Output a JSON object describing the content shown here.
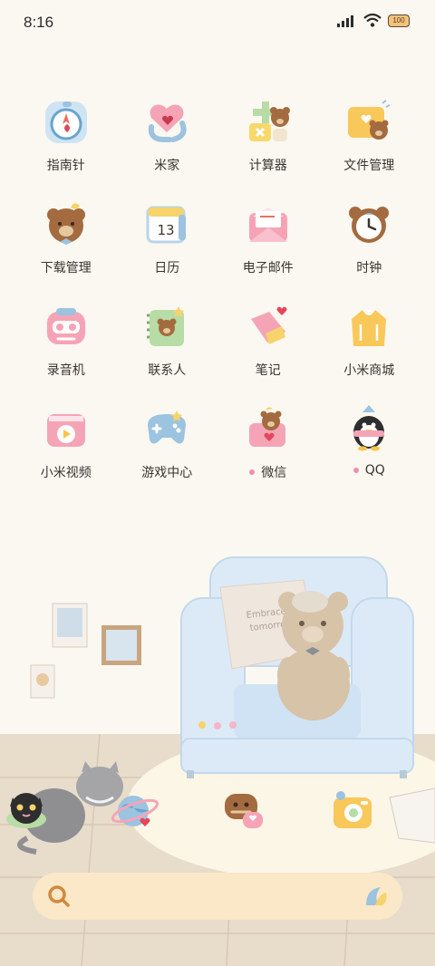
{
  "status_bar": {
    "time": "8:16",
    "battery_level": "100"
  },
  "apps": [
    {
      "label": "指南针",
      "icon": "compass-icon",
      "dot": false
    },
    {
      "label": "米家",
      "icon": "mi-home-icon",
      "dot": false
    },
    {
      "label": "计算器",
      "icon": "calculator-icon",
      "dot": false
    },
    {
      "label": "文件管理",
      "icon": "file-manager-icon",
      "dot": false
    },
    {
      "label": "下载管理",
      "icon": "downloads-icon",
      "dot": false
    },
    {
      "label": "日历",
      "icon": "calendar-icon",
      "dot": false,
      "badge": "13"
    },
    {
      "label": "电子邮件",
      "icon": "email-icon",
      "dot": false
    },
    {
      "label": "时钟",
      "icon": "clock-icon",
      "dot": false
    },
    {
      "label": "录音机",
      "icon": "recorder-icon",
      "dot": false
    },
    {
      "label": "联系人",
      "icon": "contacts-icon",
      "dot": false
    },
    {
      "label": "笔记",
      "icon": "notes-icon",
      "dot": false
    },
    {
      "label": "小米商城",
      "icon": "mi-store-icon",
      "dot": false
    },
    {
      "label": "小米视频",
      "icon": "mi-video-icon",
      "dot": false
    },
    {
      "label": "游戏中心",
      "icon": "game-center-icon",
      "dot": false
    },
    {
      "label": "微信",
      "icon": "wechat-icon",
      "dot": true
    },
    {
      "label": "QQ",
      "icon": "qq-icon",
      "dot": true
    }
  ],
  "dock": [
    {
      "icon": "phone-icon"
    },
    {
      "icon": "browser-icon"
    },
    {
      "icon": "messages-icon"
    },
    {
      "icon": "camera-icon"
    }
  ],
  "wallpaper": {
    "pillow_text": "Embrace tomorrow"
  },
  "search": {
    "icon": "search-icon",
    "assistant_icon": "assistant-icon"
  },
  "colors": {
    "background": "#fbf8f1",
    "floor": "#e8dccb",
    "sofa": "#dceaf7",
    "accent_pink": "#ec8fb0",
    "search_bg": "#fbe8c8"
  }
}
